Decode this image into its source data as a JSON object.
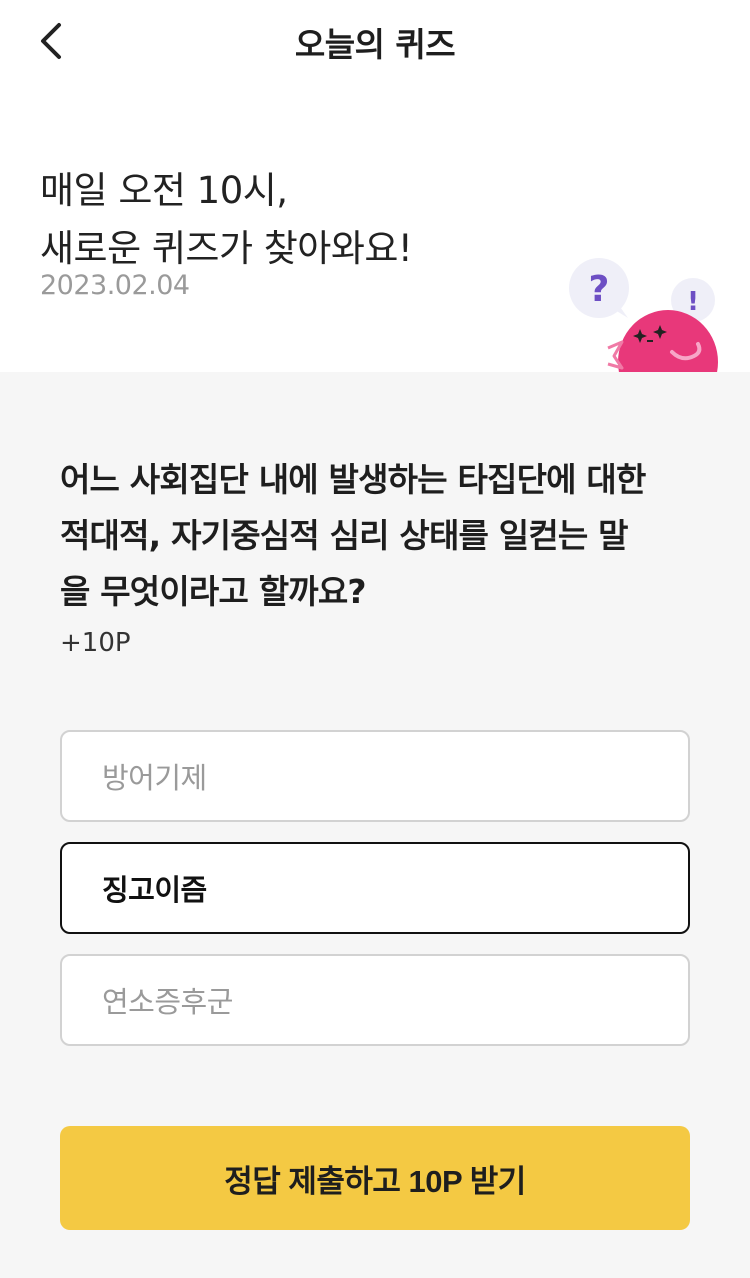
{
  "header": {
    "title": "오늘의 퀴즈",
    "back_icon": "chevron-left-icon"
  },
  "hero": {
    "line1": "매일 오전 10시,",
    "line2": "새로운 퀴즈가 찾아와요!",
    "date": "2023.02.04",
    "mascot": {
      "question_mark": "?",
      "exclamation_mark": "!",
      "colors": {
        "body": "#e8387a",
        "bubble": "#efeff8",
        "mark": "#6d4fc4"
      }
    }
  },
  "quiz": {
    "question_lines": [
      "어느 사회집단 내에 발생하는 타집단에 대한",
      "적대적, 자기중심적 심리 상태를 일컫는 말",
      "을 무엇이라고 할까요?"
    ],
    "points": "+10P",
    "options": [
      {
        "label": "방어기제",
        "selected": false
      },
      {
        "label": "징고이즘",
        "selected": true
      },
      {
        "label": "연소증후군",
        "selected": false
      }
    ]
  },
  "submit": {
    "label": "정답 제출하고 10P 받기",
    "color": "#f4c943"
  }
}
